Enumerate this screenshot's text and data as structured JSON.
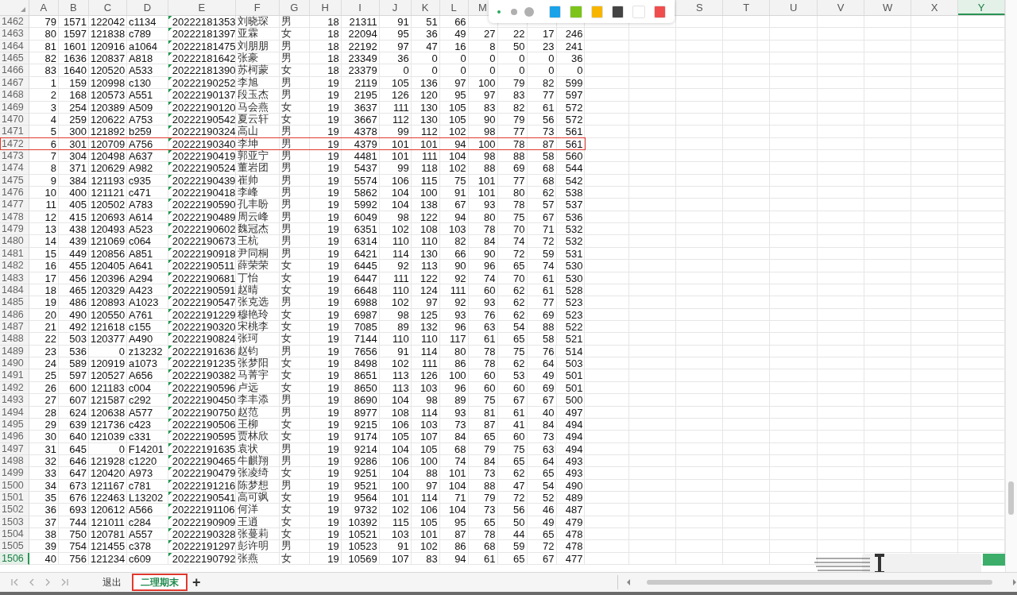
{
  "columns": [
    {
      "label": "A",
      "selected": false
    },
    {
      "label": "B",
      "selected": false
    },
    {
      "label": "C",
      "selected": false
    },
    {
      "label": "D",
      "selected": false
    },
    {
      "label": "E",
      "selected": false
    },
    {
      "label": "F",
      "selected": false
    },
    {
      "label": "G",
      "selected": false
    },
    {
      "label": "H",
      "selected": false
    },
    {
      "label": "I",
      "selected": false
    },
    {
      "label": "J",
      "selected": false
    },
    {
      "label": "K",
      "selected": false
    },
    {
      "label": "L",
      "selected": false
    },
    {
      "label": "M",
      "selected": false
    },
    {
      "label": "S",
      "selected": false
    },
    {
      "label": "T",
      "selected": false
    },
    {
      "label": "U",
      "selected": false
    },
    {
      "label": "V",
      "selected": false
    },
    {
      "label": "W",
      "selected": false
    },
    {
      "label": "X",
      "selected": false
    },
    {
      "label": "Y",
      "selected": true
    }
  ],
  "rows": [
    {
      "num": "1462",
      "active": false,
      "highlighted": false,
      "cells": [
        "79",
        "1571",
        "122042",
        "c1134",
        "20222181353",
        "刘晓琛",
        "男",
        "18",
        "21311",
        "91",
        "51",
        "66",
        null,
        null,
        null,
        null
      ]
    },
    {
      "num": "1463",
      "active": false,
      "highlighted": false,
      "cells": [
        "80",
        "1597",
        "121838",
        "c789",
        "20222181397",
        "亚霖",
        "女",
        "18",
        "22094",
        "95",
        "36",
        "49",
        "27",
        "22",
        "17",
        "246"
      ]
    },
    {
      "num": "1464",
      "active": false,
      "highlighted": false,
      "cells": [
        "81",
        "1601",
        "120916",
        "a1064",
        "20222181475",
        "刘朋朋",
        "男",
        "18",
        "22192",
        "97",
        "47",
        "16",
        "8",
        "50",
        "23",
        "241"
      ]
    },
    {
      "num": "1465",
      "active": false,
      "highlighted": false,
      "cells": [
        "82",
        "1636",
        "120837",
        "A818",
        "20222181642",
        "张豪",
        "男",
        "18",
        "23349",
        "36",
        "0",
        "0",
        "0",
        "0",
        "0",
        "36"
      ]
    },
    {
      "num": "1466",
      "active": false,
      "highlighted": false,
      "cells": [
        "83",
        "1640",
        "120520",
        "A533",
        "20222181390",
        "苏柯蒙",
        "女",
        "18",
        "23379",
        "0",
        "0",
        "0",
        "0",
        "0",
        "0",
        "0"
      ]
    },
    {
      "num": "1467",
      "active": false,
      "highlighted": false,
      "cells": [
        "1",
        "159",
        "120998",
        "c130",
        "20222190252",
        "李旭",
        "男",
        "19",
        "2119",
        "105",
        "136",
        "97",
        "100",
        "79",
        "82",
        "599"
      ]
    },
    {
      "num": "1468",
      "active": false,
      "highlighted": false,
      "cells": [
        "2",
        "168",
        "120573",
        "A551",
        "20222190137",
        "段玉杰",
        "男",
        "19",
        "2195",
        "126",
        "120",
        "95",
        "97",
        "83",
        "77",
        "597"
      ]
    },
    {
      "num": "1469",
      "active": false,
      "highlighted": false,
      "cells": [
        "3",
        "254",
        "120389",
        "A509",
        "20222190120",
        "马会燕",
        "女",
        "19",
        "3637",
        "111",
        "130",
        "105",
        "83",
        "82",
        "61",
        "572"
      ]
    },
    {
      "num": "1470",
      "active": false,
      "highlighted": false,
      "cells": [
        "4",
        "259",
        "120622",
        "A753",
        "20222190542",
        "夏云轩",
        "女",
        "19",
        "3667",
        "112",
        "130",
        "105",
        "90",
        "79",
        "56",
        "572"
      ]
    },
    {
      "num": "1471",
      "active": false,
      "highlighted": false,
      "cells": [
        "5",
        "300",
        "121892",
        "b259",
        "20222190324",
        "高山",
        "男",
        "19",
        "4378",
        "99",
        "112",
        "102",
        "98",
        "77",
        "73",
        "561"
      ]
    },
    {
      "num": "1472",
      "active": false,
      "highlighted": true,
      "cells": [
        "6",
        "301",
        "120709",
        "A756",
        "20222190340",
        "李坤",
        "男",
        "19",
        "4379",
        "101",
        "101",
        "94",
        "100",
        "78",
        "87",
        "561"
      ]
    },
    {
      "num": "1473",
      "active": false,
      "highlighted": false,
      "cells": [
        "7",
        "304",
        "120498",
        "A637",
        "20222190419",
        "郭亚宁",
        "男",
        "19",
        "4481",
        "101",
        "111",
        "104",
        "98",
        "88",
        "58",
        "560"
      ]
    },
    {
      "num": "1474",
      "active": false,
      "highlighted": false,
      "cells": [
        "8",
        "371",
        "120629",
        "A982",
        "20222190524",
        "董岩团",
        "男",
        "19",
        "5437",
        "99",
        "118",
        "102",
        "88",
        "69",
        "68",
        "544"
      ]
    },
    {
      "num": "1475",
      "active": false,
      "highlighted": false,
      "cells": [
        "9",
        "384",
        "121193",
        "c935",
        "20222190439",
        "崔帅",
        "男",
        "19",
        "5574",
        "106",
        "115",
        "75",
        "101",
        "77",
        "68",
        "542"
      ]
    },
    {
      "num": "1476",
      "active": false,
      "highlighted": false,
      "cells": [
        "10",
        "400",
        "121121",
        "c471",
        "20222190418",
        "李峰",
        "男",
        "19",
        "5862",
        "104",
        "100",
        "91",
        "101",
        "80",
        "62",
        "538"
      ]
    },
    {
      "num": "1477",
      "active": false,
      "highlighted": false,
      "cells": [
        "11",
        "405",
        "120502",
        "A783",
        "20222190590",
        "孔丰盼",
        "男",
        "19",
        "5992",
        "104",
        "138",
        "67",
        "93",
        "78",
        "57",
        "537"
      ]
    },
    {
      "num": "1478",
      "active": false,
      "highlighted": false,
      "cells": [
        "12",
        "415",
        "120693",
        "A614",
        "20222190489",
        "周云峰",
        "男",
        "19",
        "6049",
        "98",
        "122",
        "94",
        "80",
        "75",
        "67",
        "536"
      ]
    },
    {
      "num": "1479",
      "active": false,
      "highlighted": false,
      "cells": [
        "13",
        "438",
        "120493",
        "A523",
        "20222190602",
        "魏冠杰",
        "男",
        "19",
        "6351",
        "102",
        "108",
        "103",
        "78",
        "70",
        "71",
        "532"
      ]
    },
    {
      "num": "1480",
      "active": false,
      "highlighted": false,
      "cells": [
        "14",
        "439",
        "121069",
        "c064",
        "20222190673",
        "王杭",
        "男",
        "19",
        "6314",
        "110",
        "110",
        "82",
        "84",
        "74",
        "72",
        "532"
      ]
    },
    {
      "num": "1481",
      "active": false,
      "highlighted": false,
      "cells": [
        "15",
        "449",
        "120856",
        "A851",
        "20222190918",
        "尹同桐",
        "男",
        "19",
        "6421",
        "114",
        "130",
        "66",
        "90",
        "72",
        "59",
        "531"
      ]
    },
    {
      "num": "1482",
      "active": false,
      "highlighted": false,
      "cells": [
        "16",
        "455",
        "120405",
        "A641",
        "20222190511",
        "薛荣荣",
        "女",
        "19",
        "6445",
        "92",
        "113",
        "90",
        "96",
        "65",
        "74",
        "530"
      ]
    },
    {
      "num": "1483",
      "active": false,
      "highlighted": false,
      "cells": [
        "17",
        "456",
        "120396",
        "A294",
        "20222190681",
        "丁怡",
        "女",
        "19",
        "6447",
        "111",
        "122",
        "92",
        "74",
        "70",
        "61",
        "530"
      ]
    },
    {
      "num": "1484",
      "active": false,
      "highlighted": false,
      "cells": [
        "18",
        "465",
        "120329",
        "A423",
        "20222190591",
        "赵晴",
        "女",
        "19",
        "6648",
        "110",
        "124",
        "111",
        "60",
        "62",
        "61",
        "528"
      ]
    },
    {
      "num": "1485",
      "active": false,
      "highlighted": false,
      "cells": [
        "19",
        "486",
        "120893",
        "A1023",
        "20222190547",
        "张克选",
        "男",
        "19",
        "6988",
        "102",
        "97",
        "92",
        "93",
        "62",
        "77",
        "523"
      ]
    },
    {
      "num": "1486",
      "active": false,
      "highlighted": false,
      "cells": [
        "20",
        "490",
        "120550",
        "A761",
        "20222191229",
        "穆艳玲",
        "女",
        "19",
        "6987",
        "98",
        "125",
        "93",
        "76",
        "62",
        "69",
        "523"
      ]
    },
    {
      "num": "1487",
      "active": false,
      "highlighted": false,
      "cells": [
        "21",
        "492",
        "121618",
        "c155",
        "20222190320",
        "宋桃李",
        "女",
        "19",
        "7085",
        "89",
        "132",
        "96",
        "63",
        "54",
        "88",
        "522"
      ]
    },
    {
      "num": "1488",
      "active": false,
      "highlighted": false,
      "cells": [
        "22",
        "503",
        "120377",
        "A490",
        "20222190824",
        "张珂",
        "女",
        "19",
        "7144",
        "110",
        "110",
        "117",
        "61",
        "65",
        "58",
        "521"
      ]
    },
    {
      "num": "1489",
      "active": false,
      "highlighted": false,
      "cells": [
        "23",
        "536",
        "0",
        "z13232",
        "20222191636",
        "赵钧",
        "男",
        "19",
        "7656",
        "91",
        "114",
        "80",
        "78",
        "75",
        "76",
        "514"
      ]
    },
    {
      "num": "1490",
      "active": false,
      "highlighted": false,
      "cells": [
        "24",
        "589",
        "120919",
        "a1073",
        "20222191235",
        "张梦阳",
        "女",
        "19",
        "8498",
        "102",
        "111",
        "86",
        "78",
        "62",
        "64",
        "503"
      ]
    },
    {
      "num": "1491",
      "active": false,
      "highlighted": false,
      "cells": [
        "25",
        "597",
        "120527",
        "A656",
        "20222190382",
        "马菁宇",
        "女",
        "19",
        "8651",
        "113",
        "126",
        "100",
        "60",
        "53",
        "49",
        "501"
      ]
    },
    {
      "num": "1492",
      "active": false,
      "highlighted": false,
      "cells": [
        "26",
        "600",
        "121183",
        "c004",
        "20222190596",
        "卢远",
        "女",
        "19",
        "8650",
        "113",
        "103",
        "96",
        "60",
        "60",
        "69",
        "501"
      ]
    },
    {
      "num": "1493",
      "active": false,
      "highlighted": false,
      "cells": [
        "27",
        "607",
        "121587",
        "c292",
        "20222190450",
        "李丰添",
        "男",
        "19",
        "8690",
        "104",
        "98",
        "89",
        "75",
        "67",
        "67",
        "500"
      ]
    },
    {
      "num": "1494",
      "active": false,
      "highlighted": false,
      "cells": [
        "28",
        "624",
        "120638",
        "A577",
        "20222190750",
        "赵范",
        "男",
        "19",
        "8977",
        "108",
        "114",
        "93",
        "81",
        "61",
        "40",
        "497"
      ]
    },
    {
      "num": "1495",
      "active": false,
      "highlighted": false,
      "cells": [
        "29",
        "639",
        "121736",
        "c423",
        "20222190506",
        "王柳",
        "女",
        "19",
        "9215",
        "106",
        "103",
        "73",
        "87",
        "41",
        "84",
        "494"
      ]
    },
    {
      "num": "1496",
      "active": false,
      "highlighted": false,
      "cells": [
        "30",
        "640",
        "121039",
        "c331",
        "20222190595",
        "贾林欣",
        "女",
        "19",
        "9174",
        "105",
        "107",
        "84",
        "65",
        "60",
        "73",
        "494"
      ]
    },
    {
      "num": "1497",
      "active": false,
      "highlighted": false,
      "cells": [
        "31",
        "645",
        "0",
        "F14201",
        "20222191635",
        "袁状",
        "男",
        "19",
        "9214",
        "104",
        "105",
        "68",
        "79",
        "75",
        "63",
        "494"
      ]
    },
    {
      "num": "1498",
      "active": false,
      "highlighted": false,
      "cells": [
        "32",
        "646",
        "121928",
        "c1220",
        "20222190465",
        "牛麒翔",
        "男",
        "19",
        "9286",
        "106",
        "100",
        "74",
        "84",
        "65",
        "64",
        "493"
      ]
    },
    {
      "num": "1499",
      "active": false,
      "highlighted": false,
      "cells": [
        "33",
        "647",
        "120420",
        "A973",
        "20222190479",
        "张凌绮",
        "女",
        "19",
        "9251",
        "104",
        "88",
        "101",
        "73",
        "62",
        "65",
        "493"
      ]
    },
    {
      "num": "1500",
      "active": false,
      "highlighted": false,
      "cells": [
        "34",
        "673",
        "121167",
        "c781",
        "20222191216",
        "陈梦想",
        "男",
        "19",
        "9521",
        "100",
        "97",
        "104",
        "88",
        "47",
        "54",
        "490"
      ]
    },
    {
      "num": "1501",
      "active": false,
      "highlighted": false,
      "cells": [
        "35",
        "676",
        "122463",
        "L13202",
        "20222190541",
        "高可飒",
        "女",
        "19",
        "9564",
        "101",
        "114",
        "71",
        "79",
        "72",
        "52",
        "489"
      ]
    },
    {
      "num": "1502",
      "active": false,
      "highlighted": false,
      "cells": [
        "36",
        "693",
        "120612",
        "A566",
        "20222191106",
        "何洋",
        "女",
        "19",
        "9732",
        "102",
        "106",
        "104",
        "73",
        "56",
        "46",
        "487"
      ]
    },
    {
      "num": "1503",
      "active": false,
      "highlighted": false,
      "cells": [
        "37",
        "744",
        "121011",
        "c284",
        "20222190909",
        "王逍",
        "女",
        "19",
        "10392",
        "115",
        "105",
        "95",
        "65",
        "50",
        "49",
        "479"
      ]
    },
    {
      "num": "1504",
      "active": false,
      "highlighted": false,
      "cells": [
        "38",
        "750",
        "120781",
        "A557",
        "20222190328",
        "张蔓莉",
        "女",
        "19",
        "10521",
        "103",
        "101",
        "87",
        "78",
        "44",
        "65",
        "478"
      ]
    },
    {
      "num": "1505",
      "active": false,
      "highlighted": false,
      "cells": [
        "39",
        "754",
        "121455",
        "c378",
        "20222191297",
        "彭许明",
        "男",
        "19",
        "10523",
        "91",
        "102",
        "86",
        "68",
        "59",
        "72",
        "478"
      ]
    },
    {
      "num": "1506",
      "active": true,
      "highlighted": false,
      "cells": [
        "40",
        "756",
        "121234",
        "c609",
        "20222190792",
        "张燕",
        "女",
        "19",
        "10569",
        "107",
        "83",
        "94",
        "61",
        "65",
        "67",
        "477"
      ]
    }
  ],
  "pen_toolbar": {
    "sizes": [
      {
        "selected": true
      },
      {
        "selected": false
      },
      {
        "selected": false
      }
    ],
    "colors": [
      {
        "color": "#1aa3e8"
      },
      {
        "color": "#7cc41a"
      },
      {
        "color": "#f7b500"
      },
      {
        "color": "#444444"
      },
      {
        "color": "#ffffff"
      },
      {
        "color": "#f04e4e"
      }
    ]
  },
  "sheet_tabs": [
    {
      "label": "退出",
      "selected": false
    },
    {
      "label": "二理期末",
      "selected": true
    }
  ],
  "add_sheet": "+"
}
